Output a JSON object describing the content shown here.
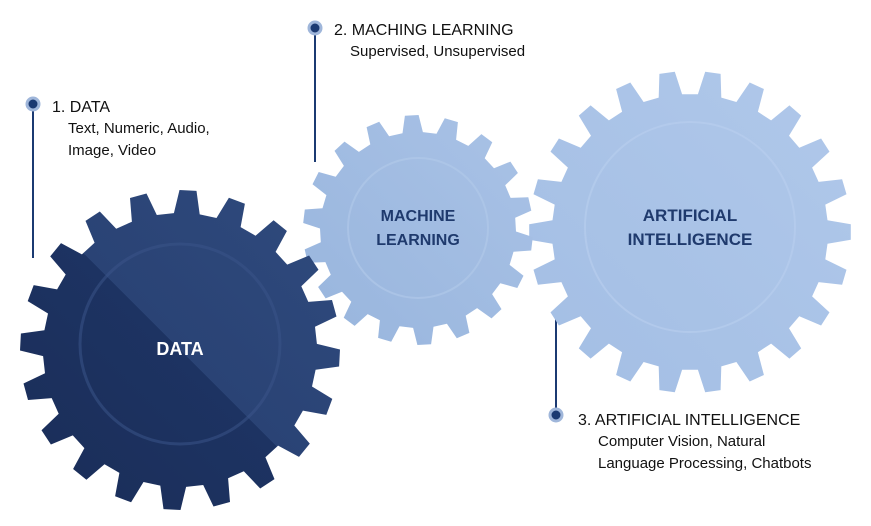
{
  "colors": {
    "data_gear_dark": "#1b2f5a",
    "data_gear_light": "#2b4477",
    "ml_gear": "#9fbbe0",
    "ai_gear": "#a8c3e7",
    "inner_text_dark_bg": "#ffffff",
    "inner_text_light_bg": "#1f3a6d",
    "callout_marker": "#1b3a72"
  },
  "gears": {
    "data": {
      "label": "DATA"
    },
    "ml": {
      "label_line1": "MACHINE",
      "label_line2": "LEARNING"
    },
    "ai": {
      "label_line1": "ARTIFICIAL",
      "label_line2": "INTELLIGENCE"
    }
  },
  "callouts": {
    "data": {
      "heading": "1. DATA",
      "items": "Text, Numeric, Audio, Image, Video"
    },
    "ml": {
      "heading": "2. MACHING LEARNING",
      "items": "Supervised, Unsupervised"
    },
    "ai": {
      "heading": "3. ARTIFICIAL INTELLIGENCE",
      "items": "Computer Vision, Natural Language Processing, Chatbots"
    }
  }
}
